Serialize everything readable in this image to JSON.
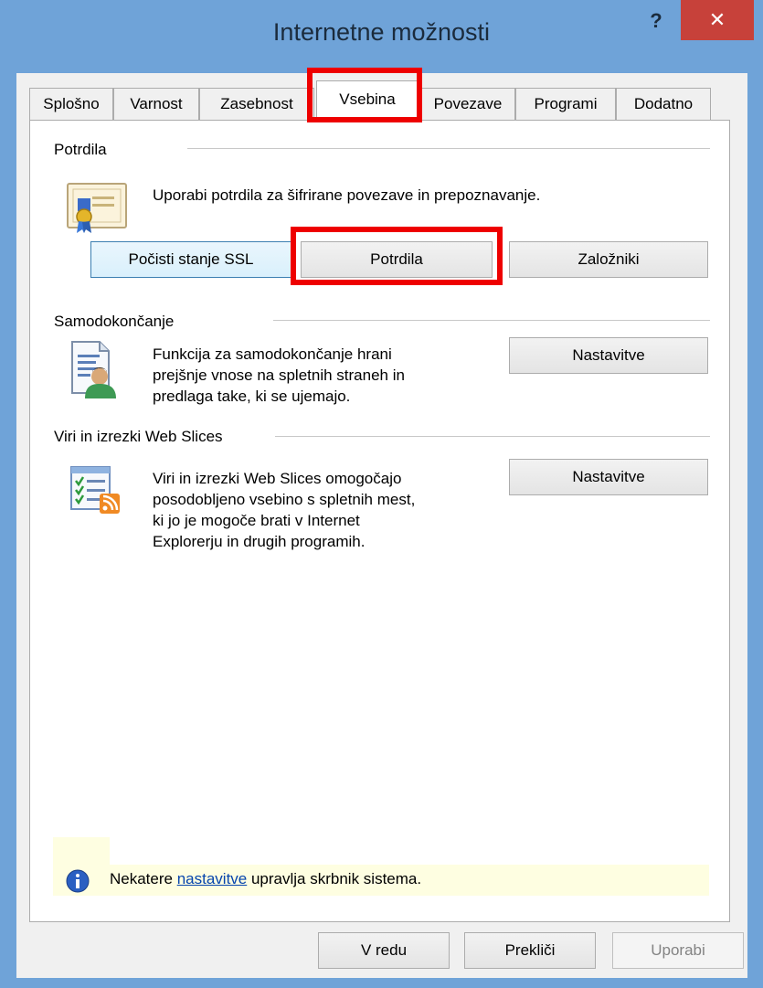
{
  "window": {
    "title": "Internetne možnosti",
    "help_label": "?",
    "close_label": "✕"
  },
  "tabs": [
    {
      "label": "Splošno"
    },
    {
      "label": "Varnost"
    },
    {
      "label": "Zasebnost"
    },
    {
      "label": "Vsebina",
      "active": true
    },
    {
      "label": "Povezave"
    },
    {
      "label": "Programi"
    },
    {
      "label": "Dodatno"
    }
  ],
  "certificates": {
    "group_label": "Potrdila",
    "description": "Uporabi potrdila za šifrirane povezave in prepoznavanje.",
    "icon": "certificate-icon",
    "clear_ssl_label": "Počisti stanje SSL",
    "certificates_label": "Potrdila",
    "publishers_label": "Založniki"
  },
  "autocomplete": {
    "group_label": "Samodokončanje",
    "description_lines": [
      "Funkcija za samodokončanje hrani",
      "prejšnje vnose na spletnih straneh in",
      "predlaga take, ki se ujemajo."
    ],
    "icon": "autocomplete-icon",
    "settings_label": "Nastavitve"
  },
  "feeds": {
    "group_label": "Viri in izrezki Web Slices",
    "description_lines": [
      "Viri in izrezki Web Slices omogočajo",
      "posodobljeno vsebino s spletnih mest,",
      "ki jo je mogoče brati v Internet",
      "Explorerju in drugih programih."
    ],
    "icon": "feeds-icon",
    "settings_label": "Nastavitve"
  },
  "info": {
    "icon": "info-icon",
    "text_before": "Nekatere ",
    "link": "nastavitve",
    "text_after": " upravlja skrbnik sistema."
  },
  "footer": {
    "ok_label": "V redu",
    "cancel_label": "Prekliči",
    "apply_label": "Uporabi"
  },
  "colors": {
    "highlight": "#ee0000",
    "title_bar": "#6fa3d8",
    "close_button": "#c7413a",
    "info_bar": "#fefee1"
  }
}
